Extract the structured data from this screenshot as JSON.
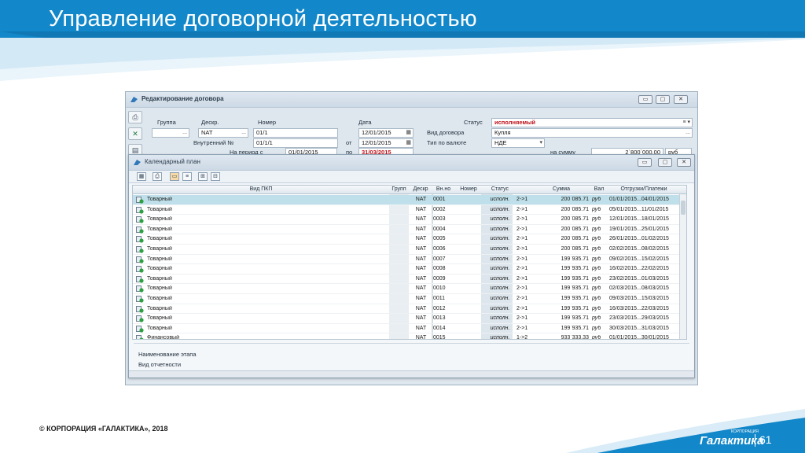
{
  "slide": {
    "title": "Управление договорной деятельностью",
    "copyright": "© КОРПОРАЦИЯ «ГАЛАКТИКА», 2018",
    "brand": "Галактика",
    "brand_sub": "КОРПОРАЦИЯ",
    "page_number": "61",
    "colors": {
      "banner": "#1287c9",
      "selected_row": "#bfe0ea",
      "status_red": "#c0121a"
    }
  },
  "contract_window": {
    "title": "Редактирование договора",
    "controls": [
      "▭",
      "▢",
      "✕"
    ],
    "side_tools": [
      "printer-icon",
      "excel-icon",
      "form-icon"
    ],
    "labels": {
      "group": "Группа",
      "descr": "Дескр.",
      "number": "Номер",
      "date": "Дата",
      "status": "Статус",
      "internal_no": "Внутренний №",
      "from": "от",
      "contract_kind": "Вид договора",
      "currency_type": "Тип по валюте",
      "period": "На период    с",
      "to": "по",
      "amount": "на сумму"
    },
    "values": {
      "group": "",
      "descr": "NAT",
      "number": "01/1",
      "date": "12/01/2015",
      "status": "исполняемый",
      "internal_no": "01/1/1",
      "from_date": "12/01/2015",
      "contract_kind": "Купля",
      "currency_type": "НДЕ",
      "period_from": "01/01/2015",
      "period_to": "31/03/2015",
      "amount": "2`800`000.00",
      "amount_cur": "руб"
    }
  },
  "plan_window": {
    "title": "Календарный план",
    "controls": [
      "▭",
      "▢",
      "✕"
    ],
    "toolbar": [
      "grid-icon",
      "printer-icon",
      "folder-icon",
      "stages-icon",
      "expand-icon",
      "collapse-icon"
    ],
    "columns": [
      "Вид ПКП",
      "Групп",
      "Дескр",
      "Вн.но",
      "Номер",
      "Статус",
      "",
      "Сумма",
      "Вал",
      "Отгрузки/Платежи"
    ],
    "rows": [
      {
        "kind": "Товарный",
        "desc": "NAT",
        "vn": "0001",
        "status": "исполн.",
        "dir": "2->1",
        "sum": "200`085.71",
        "cur": "руб",
        "dates": "01/01/2015...04/01/2015"
      },
      {
        "kind": "Товарный",
        "desc": "NAT",
        "vn": "0002",
        "status": "исполн.",
        "dir": "2->1",
        "sum": "200`085.71",
        "cur": "руб",
        "dates": "05/01/2015...11/01/2015"
      },
      {
        "kind": "Товарный",
        "desc": "NAT",
        "vn": "0003",
        "status": "исполн.",
        "dir": "2->1",
        "sum": "200`085.71",
        "cur": "руб",
        "dates": "12/01/2015...18/01/2015"
      },
      {
        "kind": "Товарный",
        "desc": "NAT",
        "vn": "0004",
        "status": "исполн.",
        "dir": "2->1",
        "sum": "200`085.71",
        "cur": "руб",
        "dates": "19/01/2015...25/01/2015"
      },
      {
        "kind": "Товарный",
        "desc": "NAT",
        "vn": "0005",
        "status": "исполн.",
        "dir": "2->1",
        "sum": "200`085.71",
        "cur": "руб",
        "dates": "26/01/2015...01/02/2015"
      },
      {
        "kind": "Товарный",
        "desc": "NAT",
        "vn": "0006",
        "status": "исполн.",
        "dir": "2->1",
        "sum": "200`085.71",
        "cur": "руб",
        "dates": "02/02/2015...08/02/2015"
      },
      {
        "kind": "Товарный",
        "desc": "NAT",
        "vn": "0007",
        "status": "исполн.",
        "dir": "2->1",
        "sum": "199`935.71",
        "cur": "руб",
        "dates": "09/02/2015...15/02/2015"
      },
      {
        "kind": "Товарный",
        "desc": "NAT",
        "vn": "0008",
        "status": "исполн.",
        "dir": "2->1",
        "sum": "199`935.71",
        "cur": "руб",
        "dates": "16/02/2015...22/02/2015"
      },
      {
        "kind": "Товарный",
        "desc": "NAT",
        "vn": "0009",
        "status": "исполн.",
        "dir": "2->1",
        "sum": "199`935.71",
        "cur": "руб",
        "dates": "23/02/2015...01/03/2015"
      },
      {
        "kind": "Товарный",
        "desc": "NAT",
        "vn": "0010",
        "status": "исполн.",
        "dir": "2->1",
        "sum": "199`935.71",
        "cur": "руб",
        "dates": "02/03/2015...08/03/2015"
      },
      {
        "kind": "Товарный",
        "desc": "NAT",
        "vn": "0011",
        "status": "исполн.",
        "dir": "2->1",
        "sum": "199`935.71",
        "cur": "руб",
        "dates": "09/03/2015...15/03/2015"
      },
      {
        "kind": "Товарный",
        "desc": "NAT",
        "vn": "0012",
        "status": "исполн.",
        "dir": "2->1",
        "sum": "199`935.71",
        "cur": "руб",
        "dates": "16/03/2015...22/03/2015"
      },
      {
        "kind": "Товарный",
        "desc": "NAT",
        "vn": "0013",
        "status": "исполн.",
        "dir": "2->1",
        "sum": "199`935.71",
        "cur": "руб",
        "dates": "23/03/2015...29/03/2015"
      },
      {
        "kind": "Товарный",
        "desc": "NAT",
        "vn": "0014",
        "status": "исполн.",
        "dir": "2->1",
        "sum": "199`935.71",
        "cur": "руб",
        "dates": "30/03/2015...31/03/2015"
      },
      {
        "kind": "Финансовый",
        "desc": "NAT",
        "vn": "0015",
        "status": "исполн.",
        "dir": "1->2",
        "sum": "933`333.33",
        "cur": "руб",
        "dates": "01/01/2015...30/01/2015"
      }
    ],
    "stage_name_label": "Наименование этапа",
    "report_type_label": "Вид отчетности"
  }
}
